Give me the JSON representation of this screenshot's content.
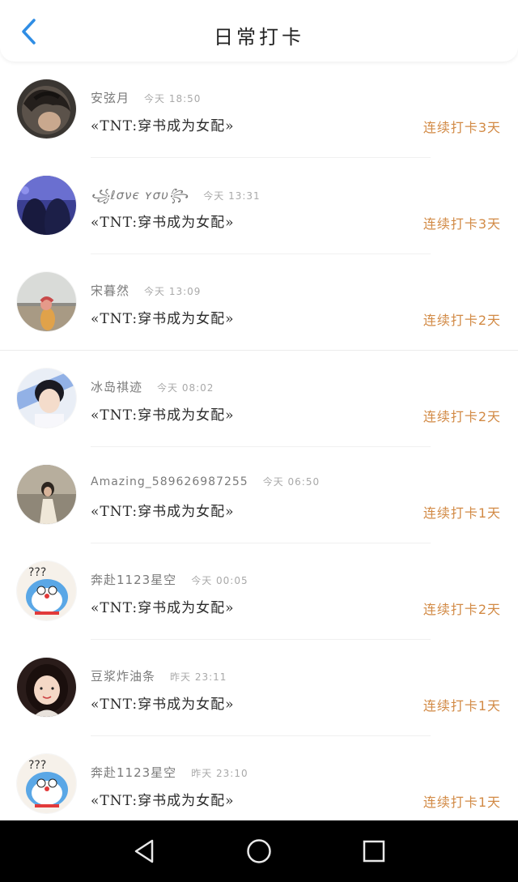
{
  "header": {
    "title": "日常打卡"
  },
  "items": [
    {
      "name": "安弦月",
      "time": "今天 18:50",
      "book": "«TNT:穿书成为女配»",
      "streak": "连续打卡3天"
    },
    {
      "name": "꧁ℓσνє ʏσυ꧂",
      "time": "今天 13:31",
      "book": "«TNT:穿书成为女配»",
      "streak": "连续打卡3天"
    },
    {
      "name": "宋暮然",
      "time": "今天 13:09",
      "book": "«TNT:穿书成为女配»",
      "streak": "连续打卡2天"
    },
    {
      "name": "冰岛祺迹",
      "time": "今天 08:02",
      "book": "«TNT:穿书成为女配»",
      "streak": "连续打卡2天"
    },
    {
      "name": "Amazing_589626987255",
      "time": "今天 06:50",
      "book": "«TNT:穿书成为女配»",
      "streak": "连续打卡1天"
    },
    {
      "name": "奔赴1123星空",
      "time": "今天 00:05",
      "book": "«TNT:穿书成为女配»",
      "streak": "连续打卡2天"
    },
    {
      "name": "豆浆炸油条",
      "time": "昨天 23:11",
      "book": "«TNT:穿书成为女配»",
      "streak": "连续打卡1天"
    },
    {
      "name": "奔赴1123星空",
      "time": "昨天 23:10",
      "book": "«TNT:穿书成为女配»",
      "streak": "连续打卡1天"
    }
  ],
  "colors": {
    "accent": "#d28a45",
    "back_arrow": "#2f8de4",
    "navbar": "#000000"
  },
  "icons": {
    "back": "chevron-left-icon",
    "nav_back": "triangle-back-icon",
    "nav_home": "circle-home-icon",
    "nav_recent": "square-recent-icon"
  }
}
